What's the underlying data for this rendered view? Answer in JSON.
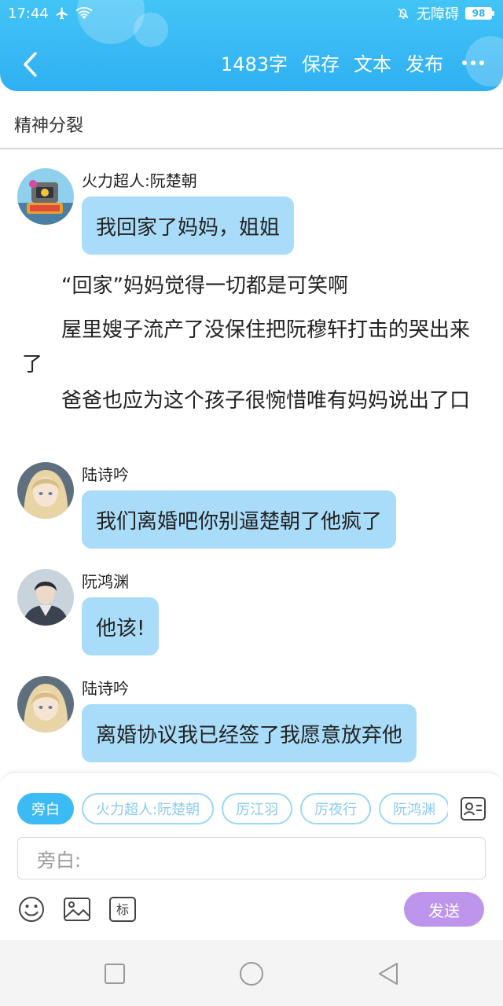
{
  "status_bar": {
    "time": "17:44",
    "accessibility": "无障碍",
    "battery": "98"
  },
  "header": {
    "word_count": "1483字",
    "save_label": "保存",
    "text_label": "文本",
    "publish_label": "发布"
  },
  "story_title": "精神分裂",
  "messages": [
    {
      "speaker": "火力超人:阮楚朝",
      "text": "我回家了妈妈，姐姐"
    },
    {
      "speaker": "陆诗吟",
      "text": "我们离婚吧你别逼楚朝了他疯了"
    },
    {
      "speaker": "阮鸿渊",
      "text": "他该!"
    },
    {
      "speaker": "陆诗吟",
      "text": "离婚协议我已经签了我愿意放弃他"
    }
  ],
  "narrations": [
    "“回家”妈妈觉得一切都是可笑啊",
    "屋里嫂子流产了没保住把阮穆轩打击的哭出来了",
    "爸爸也应为这个孩子很惋惜唯有妈妈说出了口"
  ],
  "role_chips": [
    "旁白",
    "火力超人:阮楚朝",
    "厉江羽",
    "厉夜行",
    "阮鸿渊"
  ],
  "input": {
    "placeholder": "旁白:"
  },
  "toolbar": {
    "tag_label": "标",
    "send_label": "发送"
  },
  "colors": {
    "header": "#2fb0f2",
    "bubble": "#a9dcf8",
    "send": "#be95ec",
    "chip_active": "#3cbaf4"
  }
}
